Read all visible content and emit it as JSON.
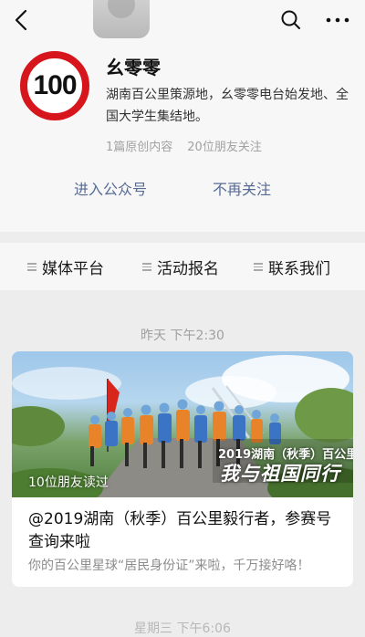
{
  "header": {
    "back_icon": "back-chevron-icon",
    "search_icon": "search-icon",
    "more_icon": "more-dots-icon"
  },
  "account": {
    "avatar_text": "100",
    "avatar_ring_color": "#d6161c",
    "name": "幺零零",
    "description": "湖南百公里策源地，幺零零电台始发地、全国大学生集结地。",
    "original_count": "1篇原创内容",
    "followers_text": "20位朋友关注",
    "enter_label": "进入公众号",
    "unfollow_label": "不再关注",
    "link_color": "#576b95"
  },
  "menu": [
    {
      "label": "媒体平台",
      "icon": "menu-lines-icon"
    },
    {
      "label": "活动报名",
      "icon": "menu-lines-icon"
    },
    {
      "label": "联系我们",
      "icon": "menu-lines-icon"
    }
  ],
  "feed": {
    "time_label": "昨天 下午2:30",
    "article": {
      "cover_caption": "10位朋友读过",
      "cover_text_line1": "2019湖南（秋季）百公里",
      "cover_text_line2": "我与祖国同行",
      "title": "@2019湖南（秋季）百公里毅行者，参赛号查询来啦",
      "digest": "你的百公里星球“居民身份证”来啦，千万接好咯！"
    },
    "next_time_label": "星期三 下午6:06"
  }
}
